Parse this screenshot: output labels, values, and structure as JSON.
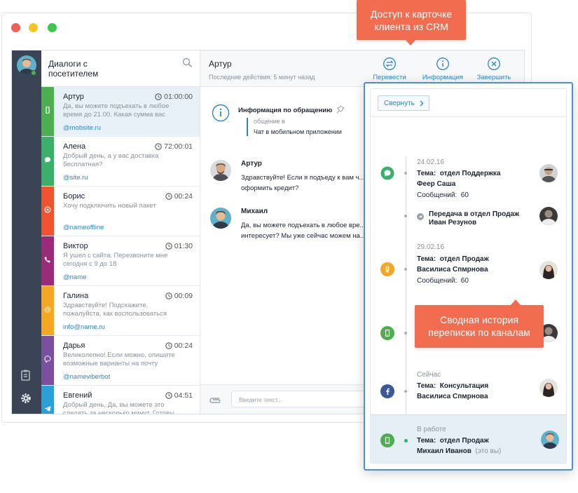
{
  "callouts": {
    "crm": "Доступ к карточке клиента из CRM",
    "history": "Сводная история переписки по каналам"
  },
  "sidebar": {
    "title": "Диалоги с посетителем"
  },
  "dialogs": [
    {
      "name": "Артур",
      "time": "01:00:00",
      "preview": "Да, вы можете подъехать в любое время до 21.00. Какая сумма вас",
      "link": "@mobsite.ru",
      "channel": "mobile",
      "color": "#4cae4f"
    },
    {
      "name": "Алена",
      "time": "72:00:01",
      "preview": "Добрый день, а у вас доставка бесплатная?",
      "link": "@site.ru",
      "channel": "chat",
      "color": "#3bb06a"
    },
    {
      "name": "Борис",
      "time": "00:24",
      "preview": "Хочу подключить новый пакет",
      "link": "@nameoffline",
      "channel": "offline",
      "color": "#f0542f"
    },
    {
      "name": "Виктор",
      "time": "01:30",
      "preview": "Я ушел с сайта. Перезвоните мне сегодня с 9 до 18",
      "link": "@name",
      "channel": "phone",
      "color": "#9b2a78"
    },
    {
      "name": "Галина",
      "time": "00:09",
      "preview": "Здравствуйте! Подскажите, пожалуйста, как воспользоваться",
      "link": "info@name.ru",
      "channel": "email",
      "color": "#f5a623"
    },
    {
      "name": "Дарья",
      "time": "00:24",
      "preview": "Великолепно! Если можно, опишите возможные варианты на почту",
      "link": "@nameviberbot",
      "channel": "viber",
      "color": "#7d4fa0"
    },
    {
      "name": "Евгений",
      "time": "04:51",
      "preview": "Добрый день, Да, вы можете это сделать за несколько минут. Готовы",
      "link": "",
      "channel": "telegram",
      "color": "#2a9fd8"
    }
  ],
  "chat": {
    "name": "Артур",
    "last_action": "Последние действия: 5 минут назад",
    "actions": {
      "transfer": "Перевести",
      "info": "Информация",
      "finish": "Завершить"
    },
    "info_title": "Информация по обращению",
    "info_sub": "общение в",
    "info_val": "Чат в мобильном приложении",
    "messages": [
      {
        "name": "Артур",
        "text": "Здравствуйте! Если я подъеду к вам ч... оформить кредит?"
      },
      {
        "name": "Михаил",
        "text": "Да, вы можете подъехать в любое вре... интересует? Мы уже сейчас можем на..."
      }
    ],
    "input_placeholder": "Введите текст..."
  },
  "history": {
    "collapse_label": "Свернуть",
    "topic_label": "Тема:",
    "messages_label": "Сообщений:",
    "entries": [
      {
        "date": "24.02.16",
        "topic": "отдел Поддержка",
        "agent": "Феер Саша",
        "count": "60"
      },
      {
        "transfer": "Передача в отдел Продаж",
        "agent": "Иван Резунов"
      },
      {
        "date": "29.02.16",
        "topic": "отдел Продаж",
        "agent": "Василиса Спмрнова",
        "count": "60"
      },
      {
        "date": "Сейчас",
        "topic": "Консультация",
        "agent": "Василиса Спмрнова"
      },
      {
        "date": "В работе",
        "topic": "отдел Продаж",
        "agent": "Михаил Иванов",
        "you": "(это вы)"
      }
    ]
  }
}
